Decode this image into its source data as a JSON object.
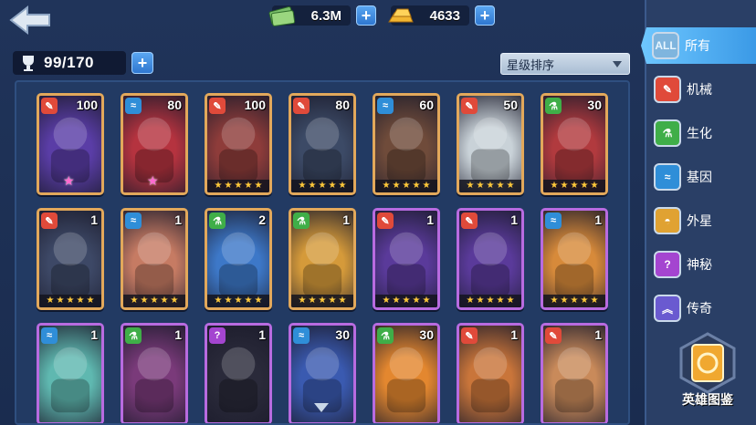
{
  "topbar": {
    "cash": "6.3M",
    "gold": "4633",
    "plus": "+"
  },
  "capacity": {
    "value": "99/170",
    "plus": "+"
  },
  "sort": {
    "label": "星级排序"
  },
  "sidebar": {
    "tabs": [
      {
        "icon": "ALL",
        "label": "所有"
      },
      {
        "icon": "mech",
        "label": "机械"
      },
      {
        "icon": "bio",
        "label": "生化"
      },
      {
        "icon": "gene",
        "label": "基因"
      },
      {
        "icon": "alien",
        "label": "外星"
      },
      {
        "icon": "?",
        "label": "神秘"
      },
      {
        "icon": "legend",
        "label": "传奇"
      }
    ],
    "codex_label": "英雄图鉴"
  },
  "cards": [
    {
      "type": "mech",
      "level": "100",
      "stars": 0,
      "pink_star": true,
      "frame": "gold",
      "art": "#5a3da6"
    },
    {
      "type": "gene",
      "level": "80",
      "stars": 0,
      "pink_star": true,
      "frame": "gold",
      "art": "#b5333f"
    },
    {
      "type": "mech",
      "level": "100",
      "stars": 5,
      "pink_star": false,
      "frame": "gold",
      "art": "#8e3c3a"
    },
    {
      "type": "mech",
      "level": "80",
      "stars": 5,
      "pink_star": false,
      "frame": "gold",
      "art": "#3c4a66"
    },
    {
      "type": "gene",
      "level": "60",
      "stars": 5,
      "pink_star": false,
      "frame": "gold",
      "art": "#6f4b3a"
    },
    {
      "type": "mech",
      "level": "50",
      "stars": 5,
      "pink_star": false,
      "frame": "gold",
      "art": "#c9d2d8"
    },
    {
      "type": "bio",
      "level": "30",
      "stars": 5,
      "pink_star": false,
      "frame": "gold",
      "art": "#b13a3e"
    },
    {
      "type": "mech",
      "level": "1",
      "stars": 5,
      "pink_star": false,
      "frame": "gold",
      "art": "#3d4866"
    },
    {
      "type": "gene",
      "level": "1",
      "stars": 5,
      "pink_star": false,
      "frame": "gold",
      "art": "#c67b63"
    },
    {
      "type": "bio",
      "level": "2",
      "stars": 5,
      "pink_star": false,
      "frame": "gold",
      "art": "#3d78c8"
    },
    {
      "type": "bio",
      "level": "1",
      "stars": 5,
      "pink_star": false,
      "frame": "gold",
      "art": "#d59a3a"
    },
    {
      "type": "mech",
      "level": "1",
      "stars": 5,
      "pink_star": false,
      "frame": "purple",
      "art": "#5a3a9a"
    },
    {
      "type": "mech",
      "level": "1",
      "stars": 5,
      "pink_star": false,
      "frame": "purple",
      "art": "#5a3a9a"
    },
    {
      "type": "gene",
      "level": "1",
      "stars": 5,
      "pink_star": false,
      "frame": "purple",
      "art": "#d78a3a"
    },
    {
      "type": "gene",
      "level": "1",
      "stars": 0,
      "pink_star": false,
      "frame": "purple",
      "art": "#5fb8b0"
    },
    {
      "type": "bio",
      "level": "1",
      "stars": 0,
      "pink_star": false,
      "frame": "purple",
      "art": "#7a3a7a"
    },
    {
      "type": "myst",
      "level": "1",
      "stars": 0,
      "pink_star": false,
      "frame": "purple",
      "art": "#2a2a3a"
    },
    {
      "type": "gene",
      "level": "30",
      "stars": 0,
      "pink_star": false,
      "frame": "purple",
      "art": "#3a5ab0"
    },
    {
      "type": "bio",
      "level": "30",
      "stars": 0,
      "pink_star": false,
      "frame": "purple",
      "art": "#e3872f"
    },
    {
      "type": "mech",
      "level": "1",
      "stars": 0,
      "pink_star": false,
      "frame": "purple",
      "art": "#c9753a"
    },
    {
      "type": "mech",
      "level": "1",
      "stars": 0,
      "pink_star": false,
      "frame": "purple",
      "art": "#c98a5a"
    }
  ]
}
